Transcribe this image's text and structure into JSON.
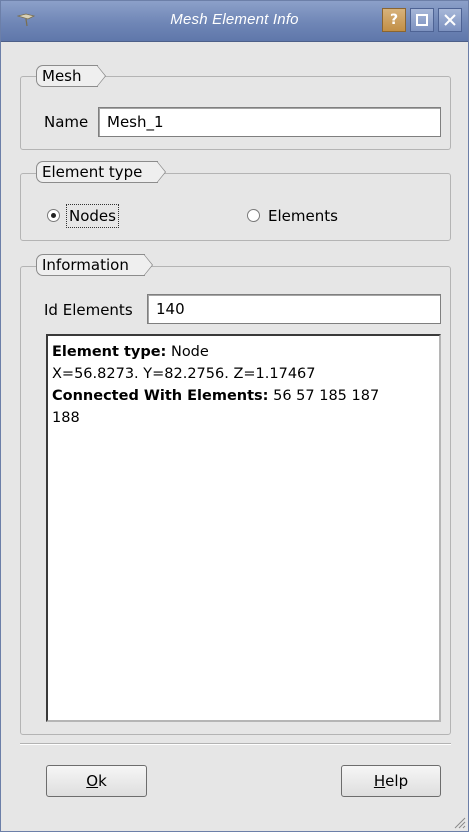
{
  "window": {
    "title": "Mesh Element Info",
    "help_glyph": "?",
    "maximize_glyph": "□",
    "close_glyph": "✕",
    "app_icon": "mesh-app-icon"
  },
  "mesh_group": {
    "label": "Mesh",
    "name_label": "Name",
    "name_value": "Mesh_1"
  },
  "element_type_group": {
    "label": "Element type",
    "options": [
      {
        "label": "Nodes",
        "selected": true
      },
      {
        "label": "Elements",
        "selected": false
      }
    ]
  },
  "information_group": {
    "label": "Information",
    "id_label": "Id Elements",
    "id_value": "140",
    "details": {
      "type_key": "Element type:",
      "type_value": " Node",
      "coords": "X=56.8273. Y=82.2756. Z=1.17467",
      "connected_key": "Connected With Elements:",
      "connected_value": " 56 57 185 187",
      "connected_value_cont": "188"
    }
  },
  "buttons": {
    "ok_label": "Ok",
    "ok_mnemonic": "O",
    "ok_rest": "k",
    "help_label": "Help",
    "help_mnemonic": "H",
    "help_rest": "elp"
  },
  "colors": {
    "titlebar": "#6f86b6",
    "window_bg": "#e6e6e6"
  }
}
